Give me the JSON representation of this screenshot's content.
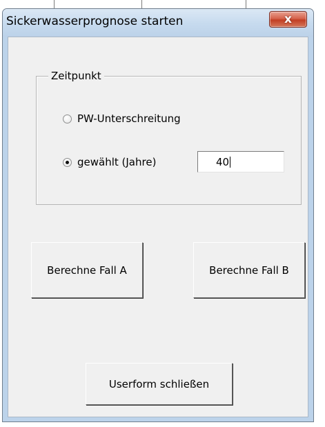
{
  "window": {
    "title": "Sickerwasserprognose starten",
    "close_glyph": "x"
  },
  "frame": {
    "label": "Zeitpunkt",
    "options": [
      {
        "label": "PW-Unterschreitung",
        "selected": false
      },
      {
        "label": "gewählt (Jahre)",
        "selected": true
      }
    ],
    "years_value": "40"
  },
  "buttons": {
    "calc_a": "Berechne Fall A",
    "calc_b": "Berechne Fall B",
    "close_form": "Userform schließen"
  },
  "colors": {
    "title_bar": "#c6daee",
    "close_button": "#c9462d",
    "client_background": "#f0f0f0"
  }
}
